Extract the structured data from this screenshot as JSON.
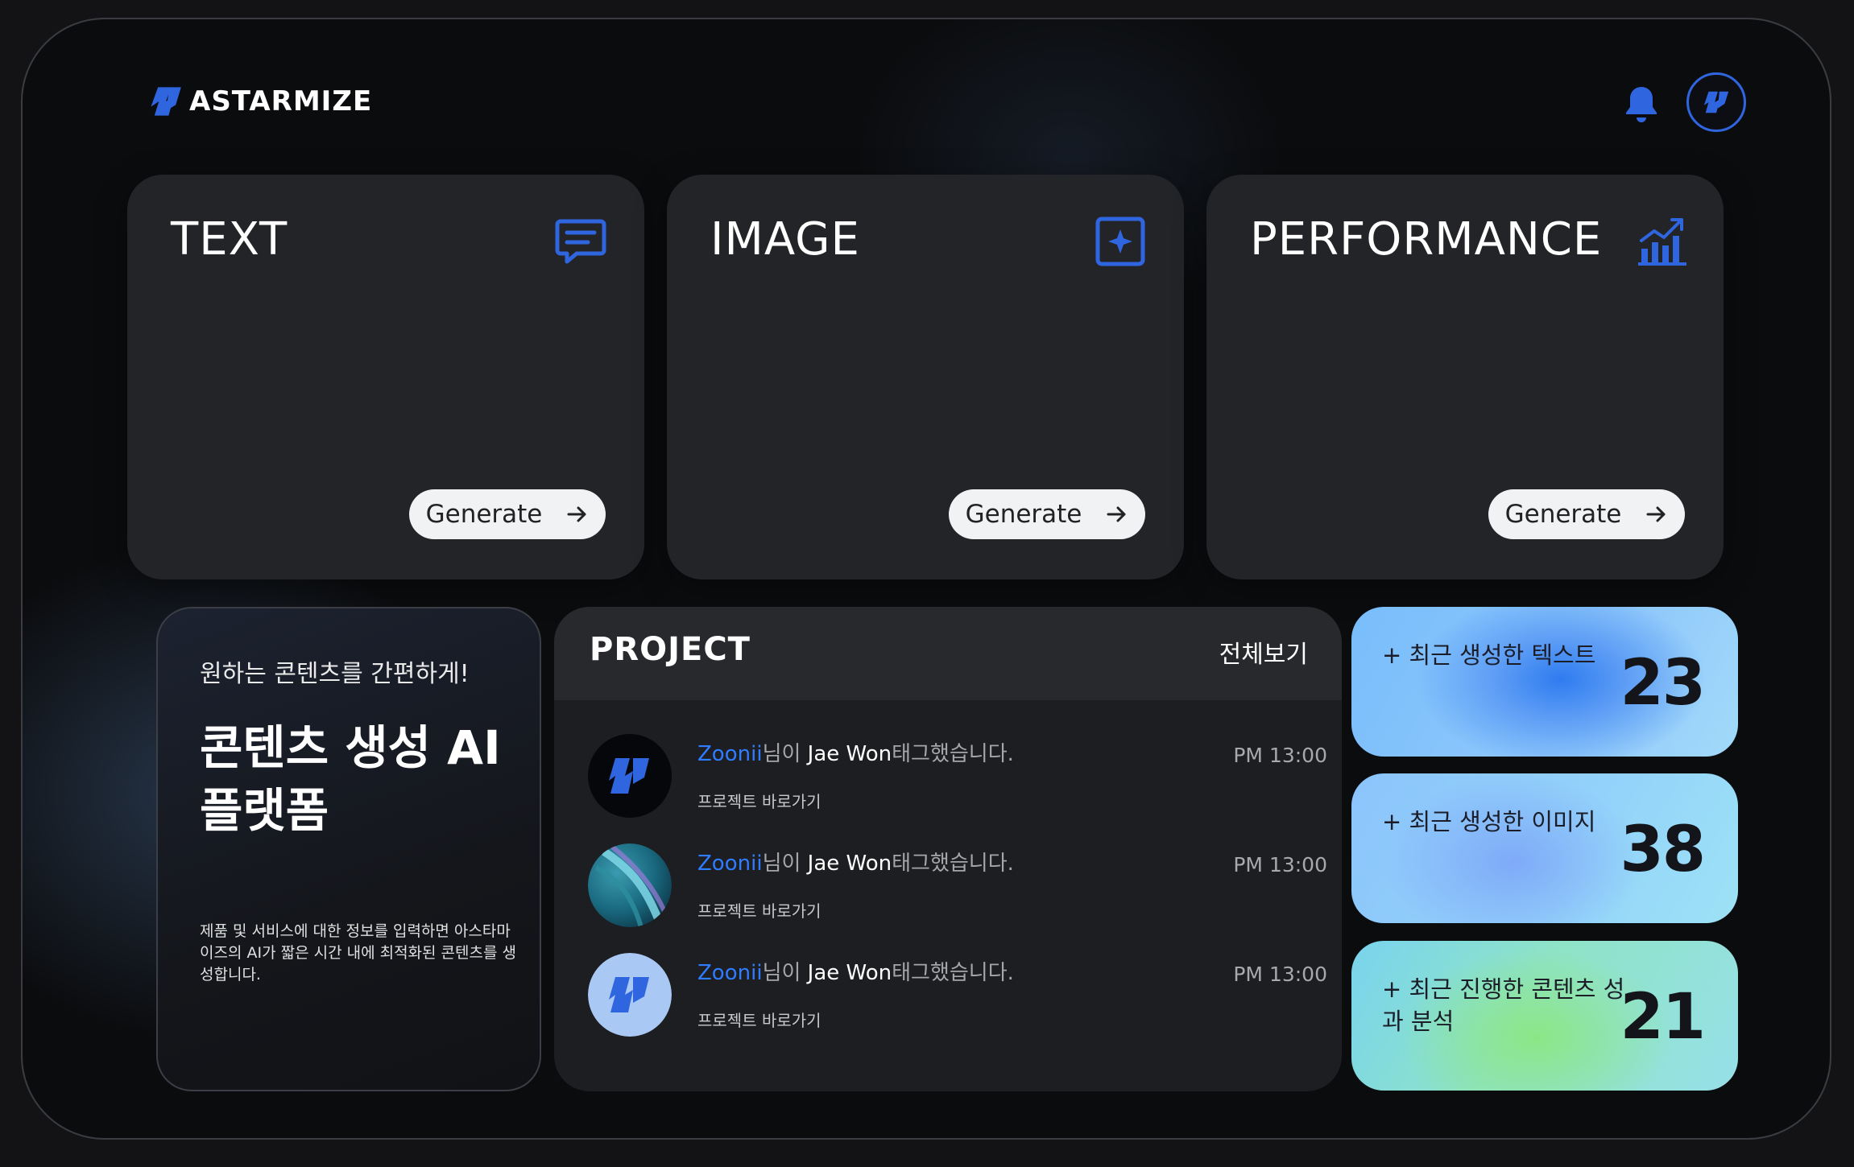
{
  "app": {
    "name": "ASTARMIZE"
  },
  "header": {
    "notification_icon": "bell-icon",
    "profile_icon": "astarmize-logo-icon"
  },
  "feature_cards": [
    {
      "title": "TEXT",
      "icon": "chat-icon",
      "button": "Generate"
    },
    {
      "title": "IMAGE",
      "icon": "image-sparkle-icon",
      "button": "Generate"
    },
    {
      "title": "PERFORMANCE",
      "icon": "chart-up-icon",
      "button": "Generate"
    }
  ],
  "promo": {
    "subtitle": "원하는 콘텐츠를 간편하게!",
    "title": "콘텐츠 생성 AI 플랫폼",
    "description": "제품 및 서비스에 대한 정보를 입력하면 아스타마이즈의 AI가 짧은 시간 내에 최적화된 콘텐츠를 생성합니다."
  },
  "project": {
    "title": "PROJECT",
    "view_all": "전체보기",
    "items": [
      {
        "user": "Zoonii",
        "mid": "님이 ",
        "target": "Jae Won",
        "action": "태그했습니다.",
        "link": "프로젝트 바로가기",
        "time": "PM 13:00",
        "avatar": "dark-logo"
      },
      {
        "user": "Zoonii",
        "mid": "님이 ",
        "target": "Jae Won",
        "action": "태그했습니다.",
        "link": "프로젝트 바로가기",
        "time": "PM 13:00",
        "avatar": "photo"
      },
      {
        "user": "Zoonii",
        "mid": "님이 ",
        "target": "Jae Won",
        "action": "태그했습니다.",
        "link": "프로젝트 바로가기",
        "time": "PM 13:00",
        "avatar": "light-logo"
      }
    ]
  },
  "stats": [
    {
      "label": "+ 최근 생성한 텍스트",
      "value": "23"
    },
    {
      "label": "+ 최근 생성한 이미지",
      "value": "38"
    },
    {
      "label": "+ 최근 진행한 콘텐츠 성과 분석",
      "value": "21"
    }
  ],
  "colors": {
    "accent": "#2f66e0",
    "link": "#2f7cff",
    "background": "#0b0c0e",
    "card": "#232427"
  }
}
